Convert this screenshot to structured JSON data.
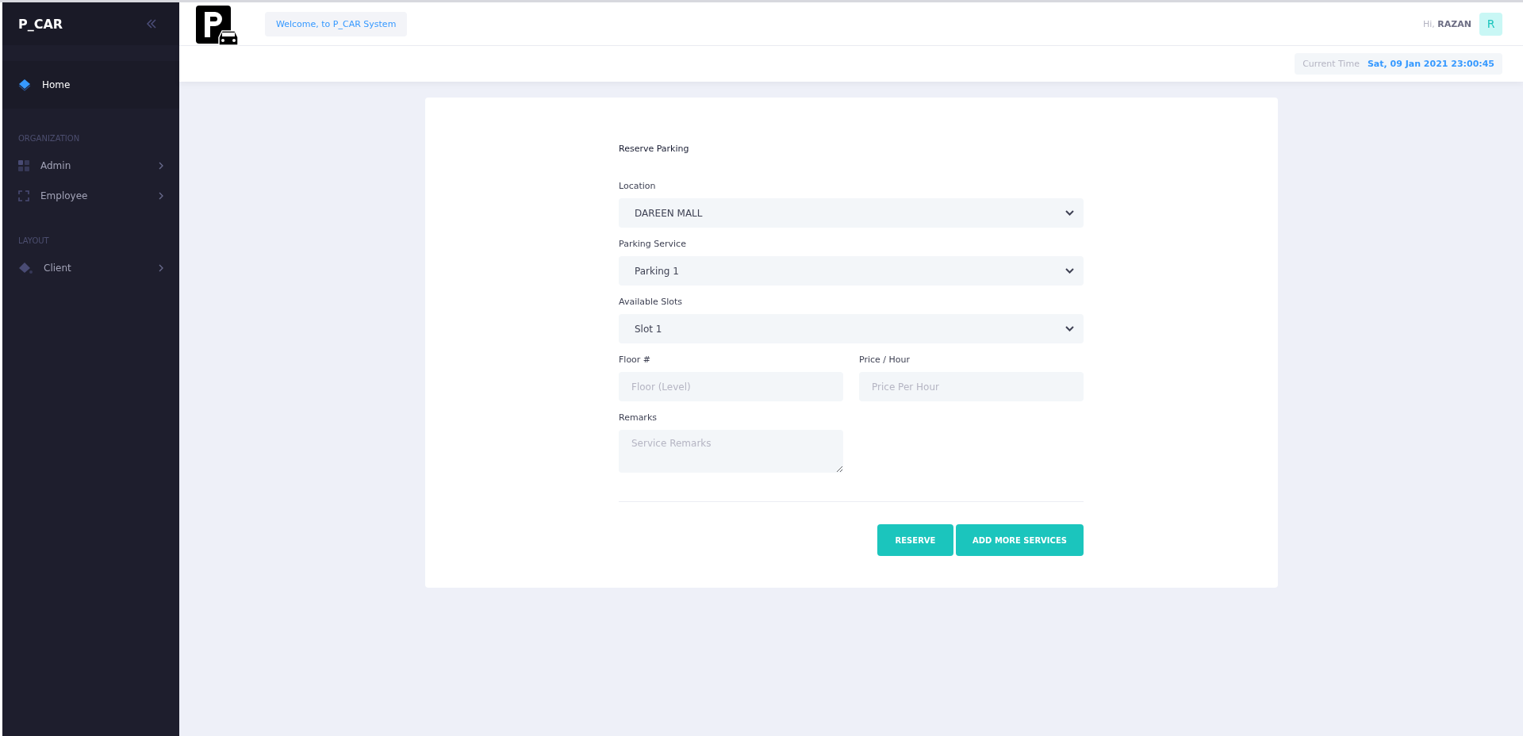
{
  "sidebar": {
    "brand": "P_CAR",
    "sections": [
      {
        "items": [
          {
            "label": "Home",
            "selected": true,
            "has_submenu": false
          }
        ]
      },
      {
        "heading": "ORGANIZATION",
        "items": [
          {
            "label": "Admin",
            "selected": false,
            "has_submenu": true
          },
          {
            "label": "Employee",
            "selected": false,
            "has_submenu": true
          }
        ]
      },
      {
        "heading": "LAYOUT",
        "items": [
          {
            "label": "Client",
            "selected": false,
            "has_submenu": true
          }
        ]
      }
    ]
  },
  "header": {
    "welcome": "Welcome, to P_CAR System",
    "greeting": "Hi,",
    "user": "RAZAN",
    "avatar": "R",
    "time_label": "Current Time",
    "time": "Sat, 09 Jan 2021 23:00:45"
  },
  "form": {
    "title": "Reserve Parking",
    "rows": [
      [
        {
          "kind": "select",
          "label": "Location",
          "value": "DAREEN MALL"
        }
      ],
      [
        {
          "kind": "select",
          "label": "Parking Service",
          "value": "Parking 1"
        }
      ],
      [
        {
          "kind": "select",
          "label": "Available Slots",
          "value": "Slot 1"
        }
      ],
      [
        {
          "kind": "input",
          "label": "Floor #",
          "placeholder": "Floor (Level)"
        },
        {
          "kind": "input",
          "label": "Price / Hour",
          "placeholder": "Price Per Hour"
        }
      ],
      [
        {
          "kind": "textarea",
          "label": "Remarks",
          "placeholder": "Service Remarks"
        },
        {
          "kind": "empty"
        }
      ]
    ],
    "buttons": [
      "RESERVE",
      "ADD MORE SERVICES"
    ]
  }
}
